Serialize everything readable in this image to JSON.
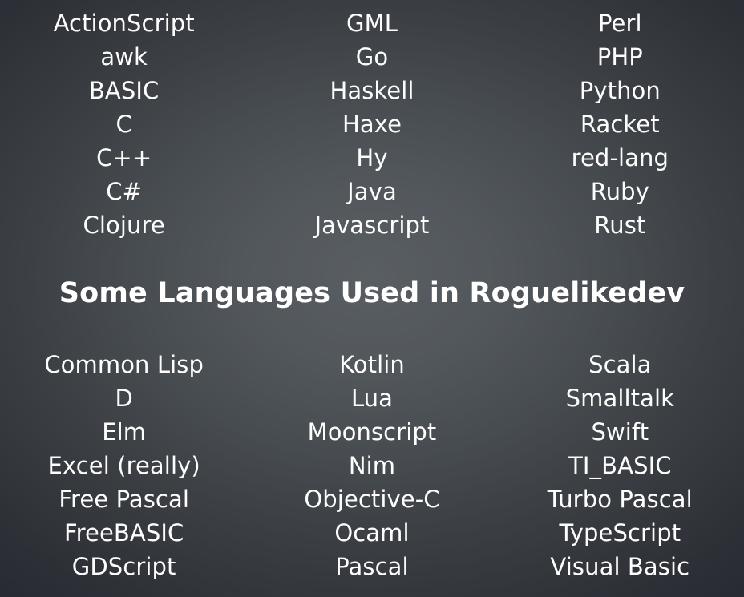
{
  "slide": {
    "title": "Some Languages Used in Roguelikedev",
    "background_center_color": "#595e63",
    "background_edge_color": "#272b31",
    "text_color": "#fdfdfd"
  },
  "top_section": {
    "columns": [
      {
        "name": "top-column-1",
        "items": [
          "ActionScript",
          "awk",
          "BASIC",
          "C",
          "C++",
          "C#",
          "Clojure"
        ]
      },
      {
        "name": "top-column-2",
        "items": [
          "GML",
          "Go",
          "Haskell",
          "Haxe",
          "Hy",
          "Java",
          "Javascript"
        ]
      },
      {
        "name": "top-column-3",
        "items": [
          "Perl",
          "PHP",
          "Python",
          "Racket",
          "red-lang",
          "Ruby",
          "Rust"
        ]
      }
    ]
  },
  "bottom_section": {
    "columns": [
      {
        "name": "bottom-column-1",
        "items": [
          "Common Lisp",
          "D",
          "Elm",
          "Excel (really)",
          "Free Pascal",
          "FreeBASIC",
          "GDScript"
        ]
      },
      {
        "name": "bottom-column-2",
        "items": [
          "Kotlin",
          "Lua",
          "Moonscript",
          "Nim",
          "Objective-C",
          "Ocaml",
          "Pascal"
        ]
      },
      {
        "name": "bottom-column-3",
        "items": [
          "Scala",
          "Smalltalk",
          "Swift",
          "TI_BASIC",
          "Turbo Pascal",
          "TypeScript",
          "Visual Basic"
        ]
      }
    ]
  }
}
